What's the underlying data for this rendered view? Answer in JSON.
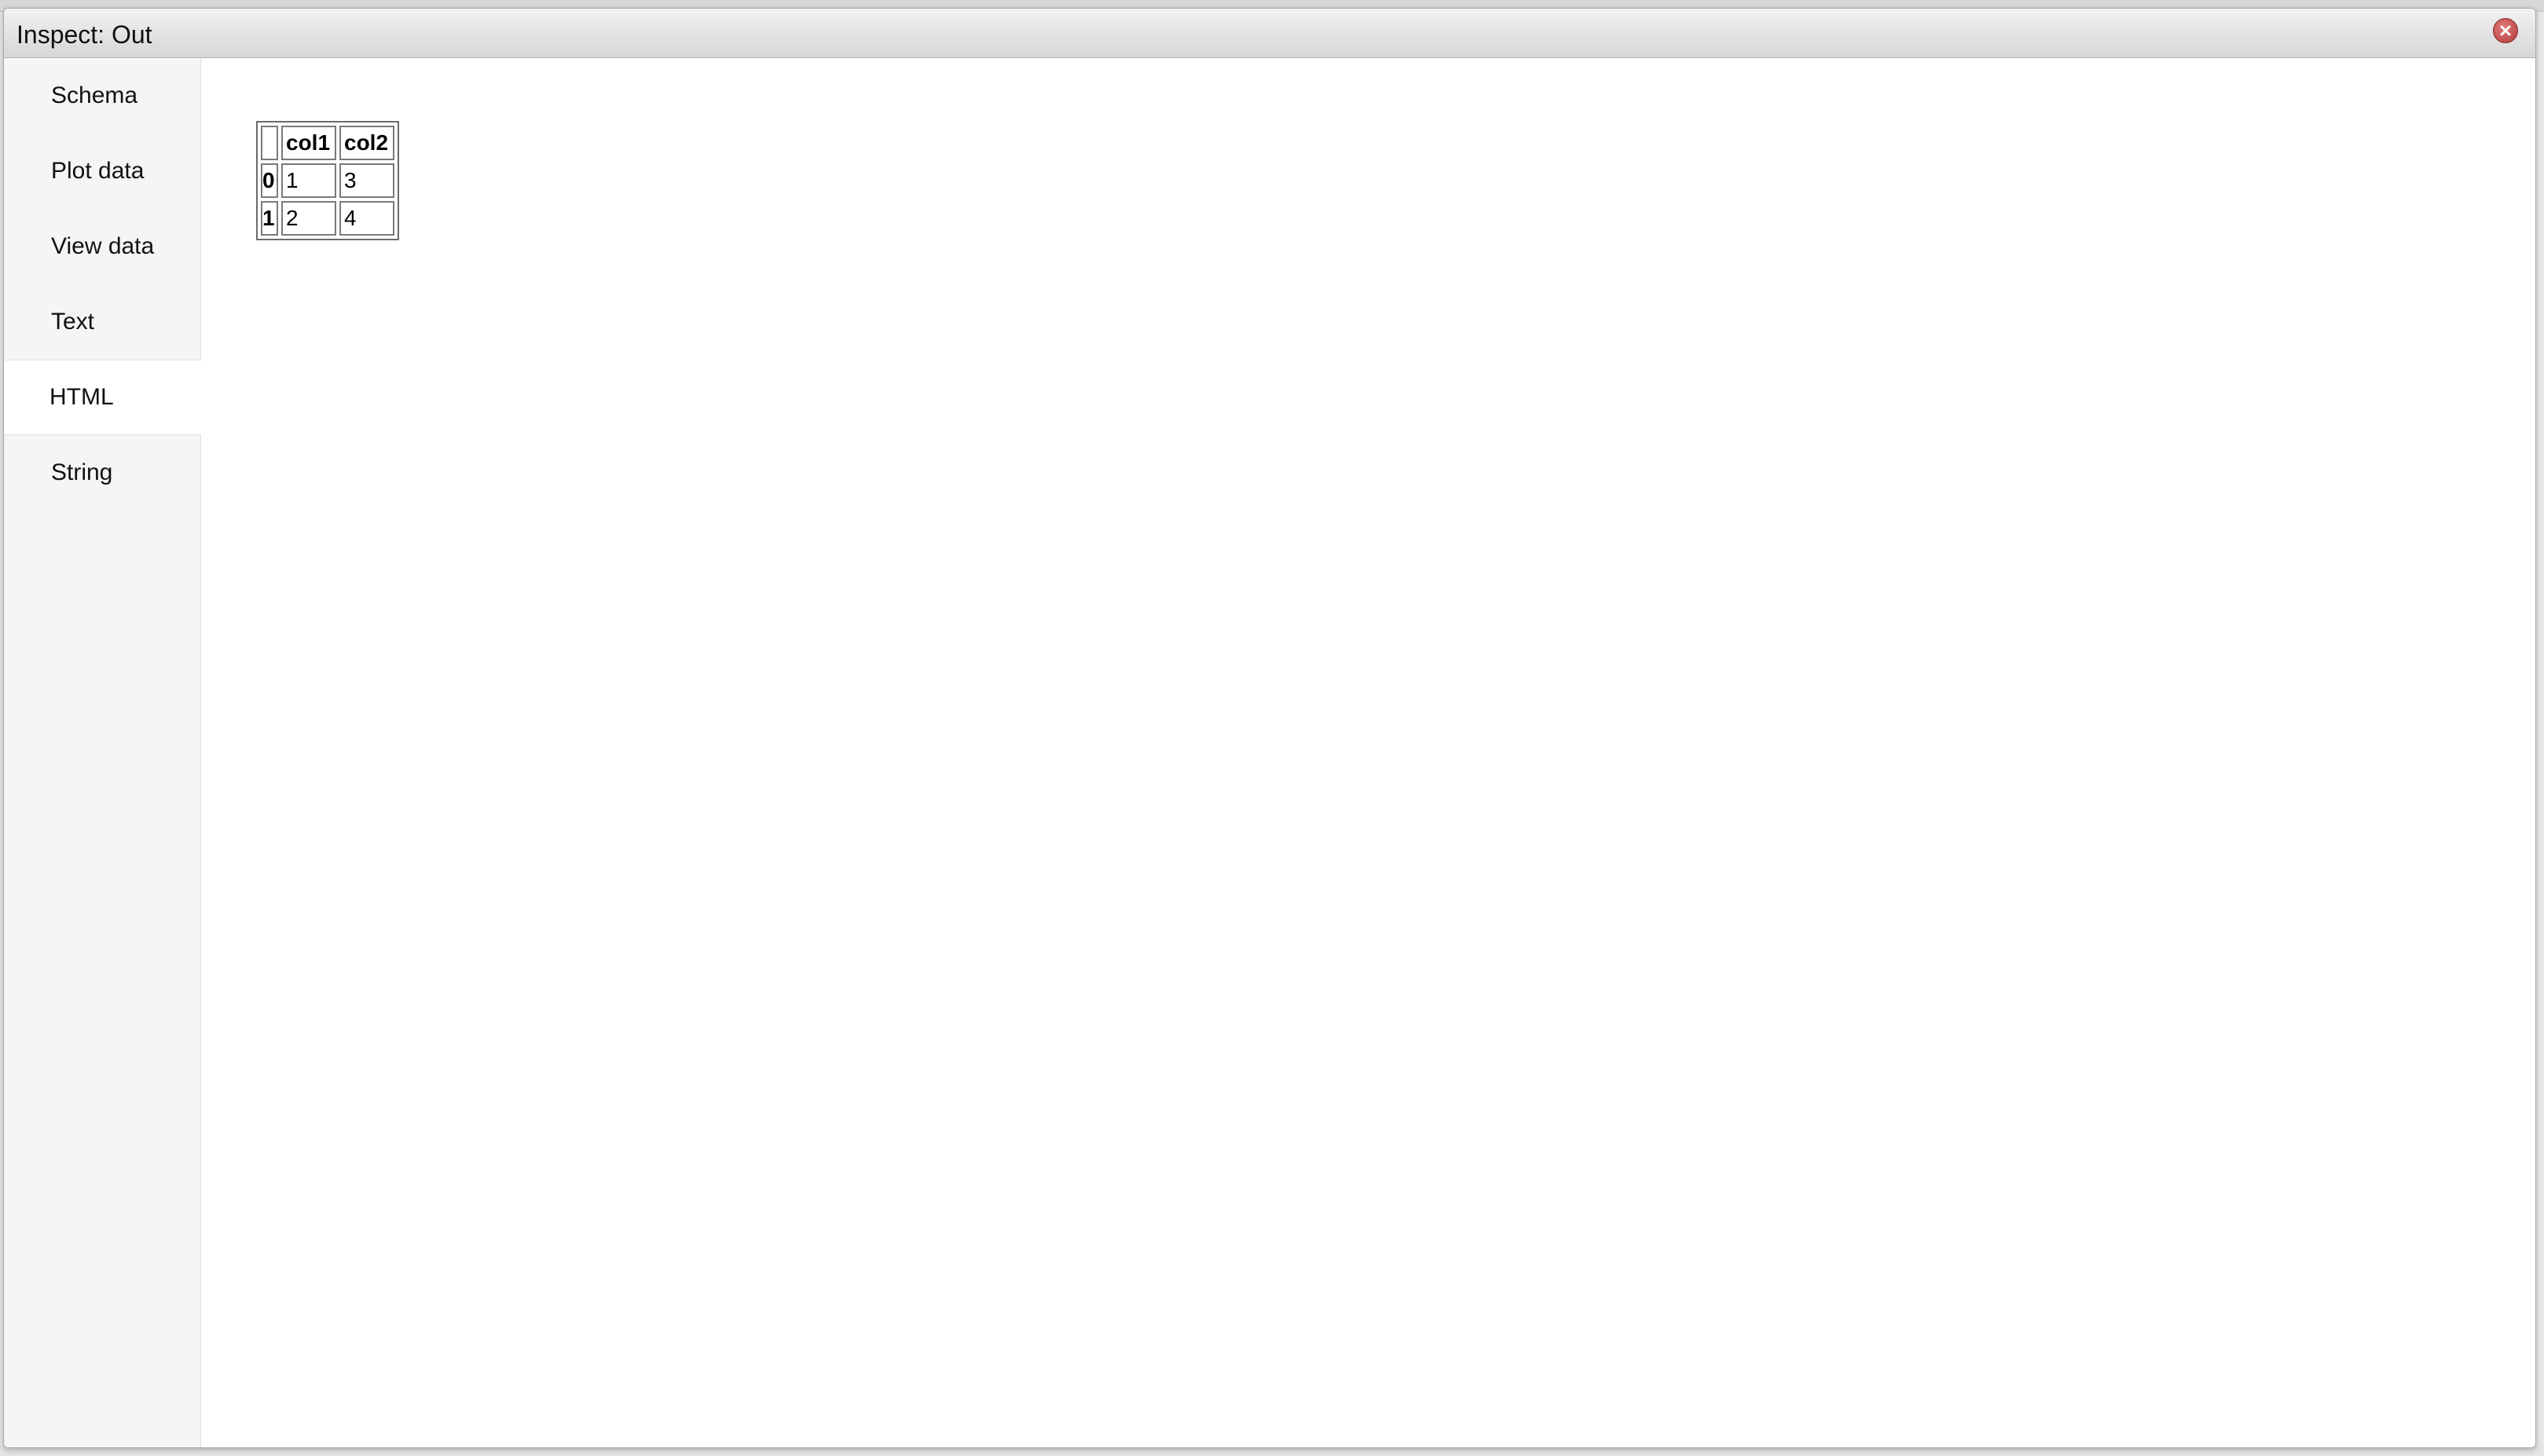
{
  "dialog": {
    "title": "Inspect: Out"
  },
  "sidebar": {
    "items": [
      {
        "label": "Schema"
      },
      {
        "label": "Plot data"
      },
      {
        "label": "View data"
      },
      {
        "label": "Text"
      },
      {
        "label": "HTML",
        "active": true
      },
      {
        "label": "String"
      }
    ]
  },
  "table": {
    "columns": [
      "col1",
      "col2"
    ],
    "rows": [
      {
        "index": "0",
        "cells": [
          "1",
          "3"
        ]
      },
      {
        "index": "1",
        "cells": [
          "2",
          "4"
        ]
      }
    ]
  },
  "colors": {
    "close_button": "#c0392b",
    "sidebar_bg": "#f5f5f5",
    "active_item_bg": "#ffffff"
  }
}
